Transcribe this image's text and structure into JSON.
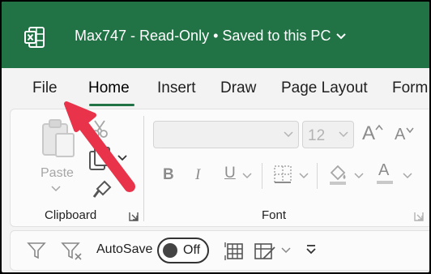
{
  "app": {
    "title": "Max747  -  Read-Only  •  Saved to this PC",
    "title_chevron": "⌄",
    "brand_color": "#217346"
  },
  "tabs": [
    {
      "label": "File"
    },
    {
      "label": "Home",
      "active": true
    },
    {
      "label": "Insert"
    },
    {
      "label": "Draw"
    },
    {
      "label": "Page Layout"
    },
    {
      "label": "Form"
    }
  ],
  "ribbon": {
    "clipboard": {
      "paste_label": "Paste",
      "group_label": "Clipboard"
    },
    "font": {
      "font_name_value": "",
      "font_size_value": "12",
      "grow_font": "A",
      "shrink_font": "A",
      "bold": "B",
      "italic": "I",
      "underline": "U",
      "font_color_letter": "A",
      "group_label": "Font"
    }
  },
  "qat": {
    "autosave_label": "AutoSave",
    "autosave_state": "Off"
  },
  "annotation": {
    "arrow_color": "#e8334a"
  }
}
